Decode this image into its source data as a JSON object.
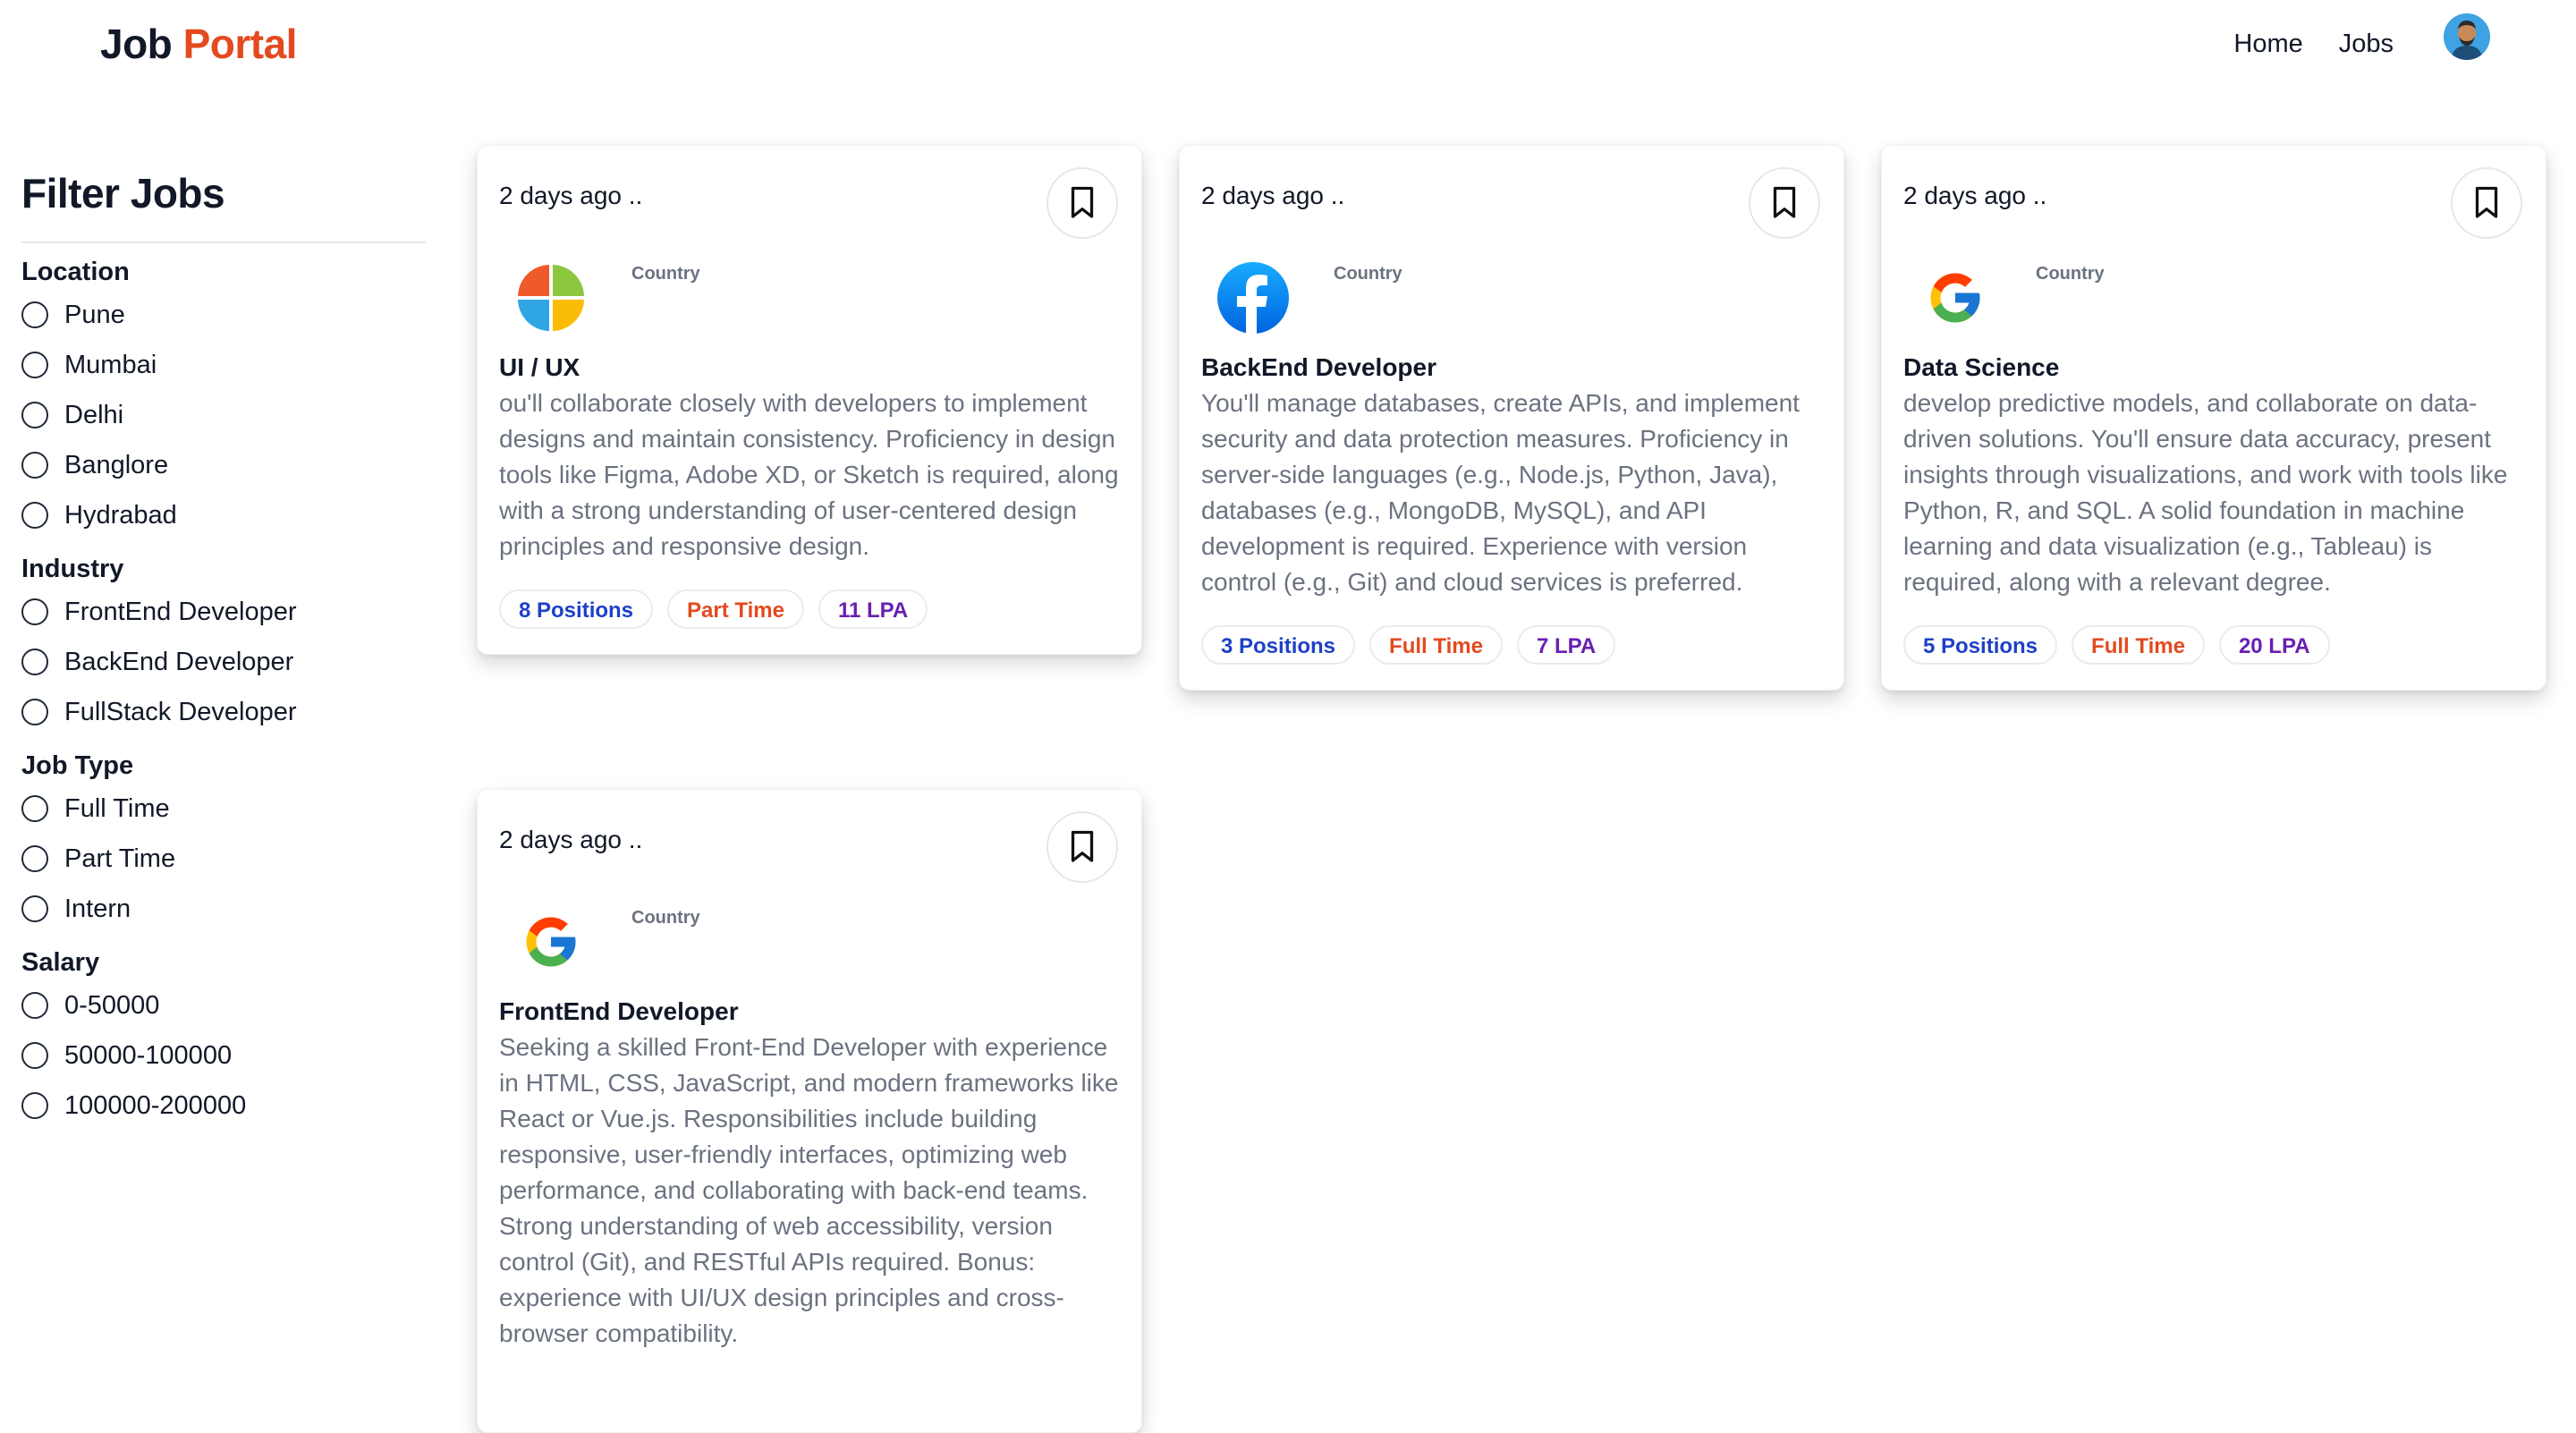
{
  "brand": {
    "part1": "Job",
    "part2": "Portal",
    "accent": "#e34a1f"
  },
  "nav": {
    "home": "Home",
    "jobs": "Jobs",
    "avatar_icon": "user-avatar"
  },
  "sidebar": {
    "title": "Filter Jobs",
    "groups": [
      {
        "title": "Location",
        "options": [
          "Pune",
          "Mumbai",
          "Delhi",
          "Banglore",
          "Hydrabad"
        ]
      },
      {
        "title": "Industry",
        "options": [
          "FrontEnd Developer",
          "BackEnd Developer",
          "FullStack Developer"
        ]
      },
      {
        "title": "Job Type",
        "options": [
          "Full Time",
          "Part Time",
          "Intern"
        ]
      },
      {
        "title": "Salary",
        "options": [
          "0-50000",
          "50000-100000",
          "100000-200000"
        ]
      }
    ]
  },
  "jobs": [
    {
      "posted": "2 days ago ..",
      "logo": "microsoft-style-logo",
      "country": "Country",
      "title": "UI / UX",
      "description": "ou'll collaborate closely with developers to implement designs and maintain consistency. Proficiency in design tools like Figma, Adobe XD, or Sketch is required, along with a strong understanding of user-centered design principles and responsive design.",
      "positions": "8 Positions",
      "type": "Part Time",
      "salary": "11 LPA"
    },
    {
      "posted": "2 days ago ..",
      "logo": "facebook-logo",
      "country": "Country",
      "title": "BackEnd Developer",
      "description": "You'll manage databases, create APIs, and implement security and data protection measures. Proficiency in server-side languages (e.g., Node.js, Python, Java), databases (e.g., MongoDB, MySQL), and API development is required. Experience with version control (e.g., Git) and cloud services is preferred.",
      "positions": "3 Positions",
      "type": "Full Time",
      "salary": "7 LPA"
    },
    {
      "posted": "2 days ago ..",
      "logo": "google-logo",
      "country": "Country",
      "title": "Data Science",
      "description": "develop predictive models, and collaborate on data-driven solutions. You'll ensure data accuracy, present insights through visualizations, and work with tools like Python, R, and SQL. A solid foundation in machine learning and data visualization (e.g., Tableau) is required, along with a relevant degree.",
      "positions": "5 Positions",
      "type": "Full Time",
      "salary": "20 LPA"
    },
    {
      "posted": "2 days ago ..",
      "logo": "google-logo",
      "country": "Country",
      "title": "FrontEnd Developer",
      "description": "Seeking a skilled Front-End Developer with experience in HTML, CSS, JavaScript, and modern frameworks like React or Vue.js. Responsibilities include building responsive, user-friendly interfaces, optimizing web performance, and collaborating with back-end teams. Strong understanding of web accessibility, version control (Git), and RESTful APIs required. Bonus: experience with UI/UX design principles and cross-browser compatibility.",
      "positions": "",
      "type": "",
      "salary": ""
    }
  ]
}
